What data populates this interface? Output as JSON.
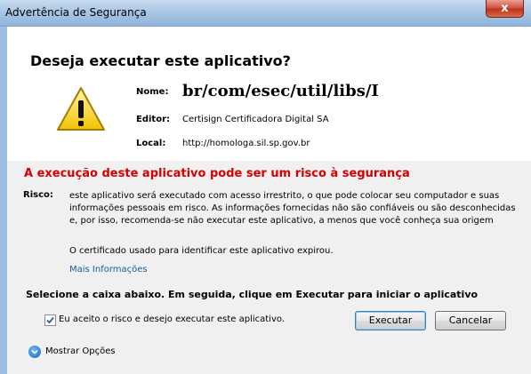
{
  "window": {
    "title": "Advertência de Segurança",
    "close_label": "x"
  },
  "dialog": {
    "question": "Deseja executar este aplicativo?",
    "name_label": "Nome:",
    "name_value": "br/com/esec/util/libs/I",
    "publisher_label": "Editor:",
    "publisher_value": "Certisign Certificadora Digital SA",
    "location_label": "Local:",
    "location_value": "http://homologa.sil.sp.gov.br"
  },
  "risk": {
    "heading": "A execução deste aplicativo pode ser um risco à segurança",
    "label": "Risco:",
    "lines": [
      "este aplicativo será executado com acesso irrestrito, o que pode colocar seu computador e suas",
      "informações pessoais em risco. As informações fornecidas não são confiáveis ou são desconhecidas",
      "e, por isso, recomenda-se não executar este aplicativo, a menos que você conheça sua origem"
    ],
    "certificate_note": "O certificado usado para identificar este aplicativo expirou.",
    "more_info": "Mais Informações"
  },
  "action": {
    "heading": "Selecione a caixa abaixo. Em seguida, clique em Executar para iniciar o aplicativo",
    "checkbox_label": "Eu aceito o risco e desejo executar este aplicativo.",
    "checkbox_checked": true,
    "run_label": "Executar",
    "cancel_label": "Cancelar",
    "show_options": "Mostrar Opções"
  },
  "icons": {
    "warning": "warning-triangle-icon",
    "check": "checkmark-icon",
    "toggle": "chevron-down-circle-icon"
  },
  "colors": {
    "risk_heading": "#d60000",
    "link": "#1a5a9c"
  }
}
